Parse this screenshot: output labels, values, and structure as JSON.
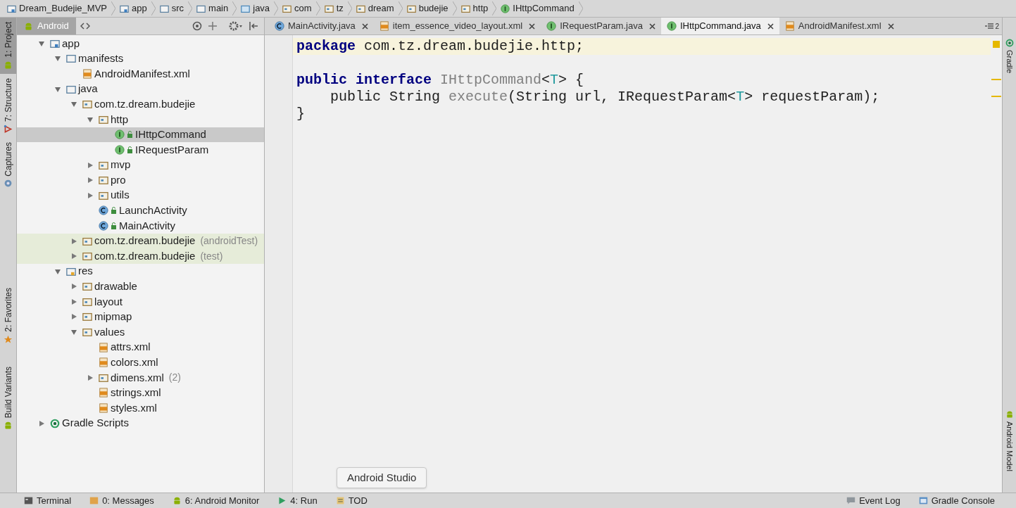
{
  "breadcrumbs": [
    {
      "label": "Dream_Budejie_MVP",
      "kind": "module"
    },
    {
      "label": "app",
      "kind": "module"
    },
    {
      "label": "src",
      "kind": "folder"
    },
    {
      "label": "main",
      "kind": "folder"
    },
    {
      "label": "java",
      "kind": "source"
    },
    {
      "label": "com",
      "kind": "package"
    },
    {
      "label": "tz",
      "kind": "package"
    },
    {
      "label": "dream",
      "kind": "package"
    },
    {
      "label": "budejie",
      "kind": "package"
    },
    {
      "label": "http",
      "kind": "package"
    },
    {
      "label": "IHttpCommand",
      "kind": "interface"
    }
  ],
  "left_tool_windows": [
    {
      "label": "1: Project",
      "kind": "android",
      "selected": true
    },
    {
      "label": "7: Structure",
      "kind": "structure",
      "selected": false
    },
    {
      "label": "Captures",
      "kind": "captures",
      "selected": false
    },
    {
      "label": "2: Favorites",
      "kind": "star",
      "selected": false
    },
    {
      "label": "Build Variants",
      "kind": "android",
      "selected": false
    }
  ],
  "right_tool_windows": [
    {
      "label": "Gradle",
      "kind": "gradle"
    },
    {
      "label": "Android Model",
      "kind": "android"
    }
  ],
  "project_panel": {
    "view": "Android",
    "tree": [
      {
        "label": "app",
        "kind": "module",
        "expanded": true,
        "selected": false,
        "test_scope": false,
        "children": [
          {
            "label": "manifests",
            "kind": "folder",
            "expanded": true,
            "selected": false,
            "test_scope": false,
            "children": [
              {
                "label": "AndroidManifest.xml",
                "kind": "xml",
                "selected": false,
                "test_scope": false
              }
            ]
          },
          {
            "label": "java",
            "kind": "folder",
            "expanded": true,
            "selected": false,
            "test_scope": false,
            "children": [
              {
                "label": "com.tz.dream.budejie",
                "kind": "package",
                "expanded": true,
                "selected": false,
                "test_scope": false,
                "children": [
                  {
                    "label": "http",
                    "kind": "package",
                    "expanded": true,
                    "selected": false,
                    "test_scope": false,
                    "children": [
                      {
                        "label": "IHttpCommand",
                        "kind": "interface",
                        "selected": true,
                        "test_scope": false
                      },
                      {
                        "label": "IRequestParam",
                        "kind": "interface",
                        "selected": false,
                        "test_scope": false
                      }
                    ]
                  },
                  {
                    "label": "mvp",
                    "kind": "package",
                    "expanded": false,
                    "selected": false,
                    "test_scope": false
                  },
                  {
                    "label": "pro",
                    "kind": "package",
                    "expanded": false,
                    "selected": false,
                    "test_scope": false
                  },
                  {
                    "label": "utils",
                    "kind": "package",
                    "expanded": false,
                    "selected": false,
                    "test_scope": false
                  },
                  {
                    "label": "LaunchActivity",
                    "kind": "class",
                    "selected": false,
                    "test_scope": false
                  },
                  {
                    "label": "MainActivity",
                    "kind": "class",
                    "selected": false,
                    "test_scope": false
                  }
                ]
              },
              {
                "label": "com.tz.dream.budejie",
                "note": "(androidTest)",
                "kind": "package",
                "expanded": false,
                "selected": false,
                "test_scope": true
              },
              {
                "label": "com.tz.dream.budejie",
                "note": "(test)",
                "kind": "package",
                "expanded": false,
                "selected": false,
                "test_scope": true
              }
            ]
          },
          {
            "label": "res",
            "kind": "res",
            "expanded": true,
            "selected": false,
            "test_scope": false,
            "children": [
              {
                "label": "drawable",
                "kind": "package",
                "expanded": false,
                "selected": false,
                "test_scope": false
              },
              {
                "label": "layout",
                "kind": "package",
                "expanded": false,
                "selected": false,
                "test_scope": false
              },
              {
                "label": "mipmap",
                "kind": "package",
                "expanded": false,
                "selected": false,
                "test_scope": false
              },
              {
                "label": "values",
                "kind": "package",
                "expanded": true,
                "selected": false,
                "test_scope": false,
                "children": [
                  {
                    "label": "attrs.xml",
                    "kind": "xml",
                    "selected": false,
                    "test_scope": false
                  },
                  {
                    "label": "colors.xml",
                    "kind": "xml",
                    "selected": false,
                    "test_scope": false
                  },
                  {
                    "label": "dimens.xml",
                    "note": "(2)",
                    "kind": "package",
                    "expanded": false,
                    "selected": false,
                    "test_scope": false
                  },
                  {
                    "label": "strings.xml",
                    "kind": "xml",
                    "selected": false,
                    "test_scope": false
                  },
                  {
                    "label": "styles.xml",
                    "kind": "xml",
                    "selected": false,
                    "test_scope": false
                  }
                ]
              }
            ]
          }
        ]
      },
      {
        "label": "Gradle Scripts",
        "kind": "gradle",
        "expanded": false,
        "selected": false,
        "test_scope": false
      }
    ]
  },
  "editor_tabs": [
    {
      "label": "MainActivity.java",
      "kind": "class",
      "selected": false
    },
    {
      "label": "item_essence_video_layout.xml",
      "kind": "xml",
      "selected": false
    },
    {
      "label": "IRequestParam.java",
      "kind": "interface",
      "selected": false
    },
    {
      "label": "IHttpCommand.java",
      "kind": "interface",
      "selected": true
    },
    {
      "label": "AndroidManifest.xml",
      "kind": "xml",
      "selected": false
    }
  ],
  "tab_count": "2",
  "code_lines": [
    {
      "kind": "code",
      "current": true,
      "tokens": [
        {
          "kind": "keyword",
          "text": "package"
        },
        {
          "kind": "plain",
          "text": " com.tz.dream.budejie.http;"
        }
      ]
    },
    {
      "kind": "blank"
    },
    {
      "kind": "code",
      "current": false,
      "tokens": [
        {
          "kind": "keyword",
          "text": "public interface"
        },
        {
          "kind": "unused",
          "text": " IHttpCommand"
        },
        {
          "kind": "plain",
          "text": "<"
        },
        {
          "kind": "typeparam",
          "text": "T"
        },
        {
          "kind": "plain",
          "text": "> {"
        }
      ]
    },
    {
      "kind": "code",
      "current": false,
      "tokens": [
        {
          "kind": "plain",
          "text": "    public String "
        },
        {
          "kind": "unused",
          "text": "execute"
        },
        {
          "kind": "plain",
          "text": "(String url, IRequestParam<"
        },
        {
          "kind": "typeparam",
          "text": "T"
        },
        {
          "kind": "plain",
          "text": "> requestParam);"
        }
      ]
    },
    {
      "kind": "code",
      "current": false,
      "tokens": [
        {
          "kind": "plain",
          "text": "}"
        }
      ]
    }
  ],
  "tooltip": "Android Studio",
  "bottom_tools_left": [
    {
      "label": "Terminal",
      "kind": "terminal"
    },
    {
      "label": "0: Messages",
      "kind": "messages"
    },
    {
      "label": "6: Android Monitor",
      "kind": "android"
    },
    {
      "label": "4: Run",
      "kind": "run"
    },
    {
      "label": "TOD",
      "kind": "todo"
    }
  ],
  "bottom_tools_right": [
    {
      "label": "Event Log",
      "kind": "log"
    },
    {
      "label": "Gradle Console",
      "kind": "console"
    }
  ]
}
